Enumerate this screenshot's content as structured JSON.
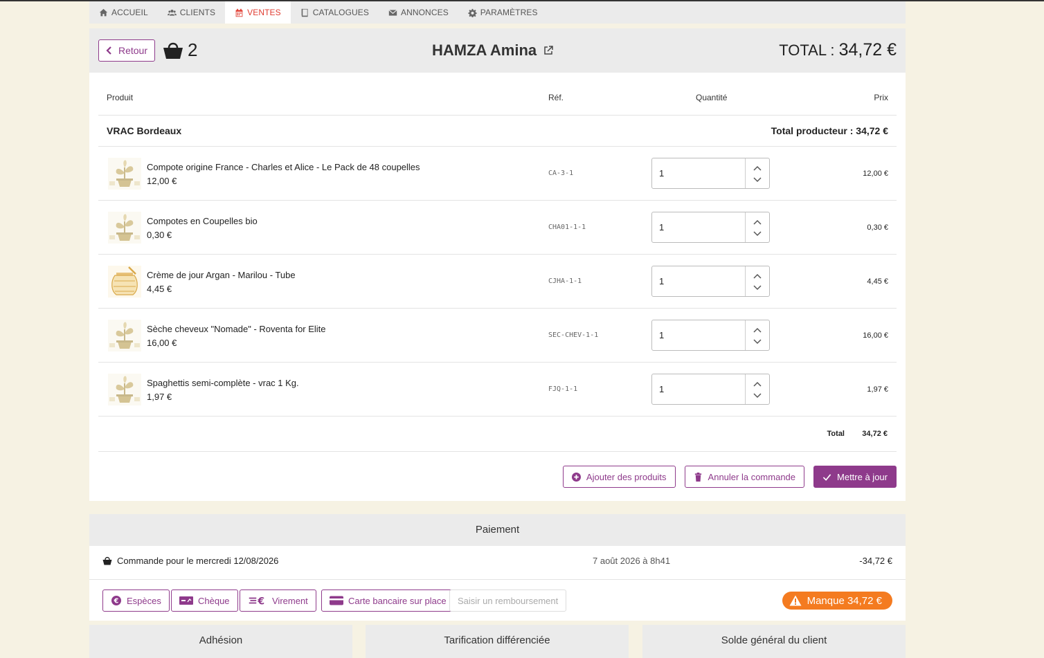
{
  "nav": {
    "items": [
      {
        "label": "ACCUEIL",
        "icon": "home-icon"
      },
      {
        "label": "CLIENTS",
        "icon": "users-icon"
      },
      {
        "label": "VENTES",
        "icon": "calendar-icon"
      },
      {
        "label": "CATALOGUES",
        "icon": "book-icon"
      },
      {
        "label": "ANNONCES",
        "icon": "envelope-icon"
      },
      {
        "label": "PARAMÈTRES",
        "icon": "gear-icon"
      }
    ],
    "active": "VENTES"
  },
  "header": {
    "back_label": "Retour",
    "basket_count": "2",
    "client_name": "HAMZA Amina",
    "total_label": "TOTAL : ",
    "total_value": "34,72 €"
  },
  "table": {
    "headers": {
      "product": "Produit",
      "ref": "Réf.",
      "quantity": "Quantité",
      "price": "Prix"
    },
    "producer": {
      "name": "VRAC Bordeaux",
      "total": "Total producteur : 34,72 €"
    },
    "items": [
      {
        "name": "Compote origine France - Charles et Alice - Le Pack de 48 coupelles",
        "unit_price": "12,00 €",
        "ref": "CA-3-1",
        "qty": "1",
        "price": "12,00 €",
        "thumb": "plant-placeholder"
      },
      {
        "name": "Compotes en Coupelles bio",
        "unit_price": "0,30 €",
        "ref": "CHA01-1-1",
        "qty": "1",
        "price": "0,30 €",
        "thumb": "plant-placeholder"
      },
      {
        "name": "Crème de jour Argan - Marilou - Tube",
        "unit_price": "4,45 €",
        "ref": "CJHA-1-1",
        "qty": "1",
        "price": "4,45 €",
        "thumb": "honey-jar"
      },
      {
        "name": "Sèche cheveux \"Nomade\" - Roventa for Elite",
        "unit_price": "16,00 €",
        "ref": "SEC-CHEV-1-1",
        "qty": "1",
        "price": "16,00 €",
        "thumb": "plant-placeholder"
      },
      {
        "name": "Spaghettis semi-complète - vrac 1 Kg.",
        "unit_price": "1,97 €",
        "ref": "FJQ-1-1",
        "qty": "1",
        "price": "1,97 €",
        "thumb": "plant-placeholder"
      }
    ],
    "total_label": "Total",
    "total_value": "34,72 €"
  },
  "actions": {
    "add": "Ajouter des produits",
    "cancel": "Annuler la commande",
    "update": "Mettre à jour"
  },
  "payment": {
    "title": "Paiement",
    "order_label": "Commande pour le mercredi 12/08/2026",
    "order_date": "7 août 2026 à 8h41",
    "order_amount": "-34,72 €",
    "buttons": {
      "cash": "Espèces",
      "cheque": "Chèque",
      "transfer": "Virement",
      "card": "Carte bancaire sur place",
      "refund": "Saisir un remboursement"
    },
    "missing": "Manque 34,72 €"
  },
  "sections": {
    "membership": "Adhésion",
    "pricing": "Tarification différenciée",
    "balance": "Solde général du client"
  },
  "colors": {
    "accent": "#8e3a8b",
    "active_tab": "#e03c31",
    "warning": "#f47b20",
    "background": "#f6f2e3"
  }
}
